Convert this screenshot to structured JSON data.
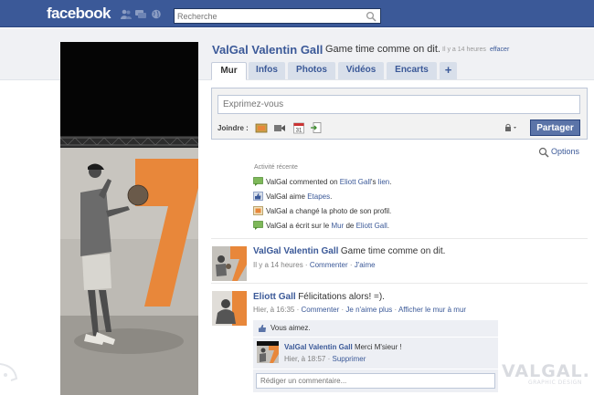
{
  "topbar": {
    "logo": "facebook",
    "search_placeholder": "Recherche"
  },
  "profile": {
    "name": "ValGal Valentin Gall",
    "status": "Game time comme on dit.",
    "status_time": "Il y a 14 heures",
    "clear_label": "effacer"
  },
  "tabs": [
    {
      "label": "Mur",
      "active": true
    },
    {
      "label": "Infos"
    },
    {
      "label": "Photos"
    },
    {
      "label": "Vidéos"
    },
    {
      "label": "Encarts"
    },
    {
      "label": "+"
    }
  ],
  "composer": {
    "placeholder": "Exprimez-vous",
    "attach_label": "Joindre :",
    "share_label": "Partager"
  },
  "options_label": "Options",
  "recent_activity": {
    "title": "Activité récente",
    "items": [
      {
        "before": "ValGal commented on ",
        "link1": "Eliott Gall",
        "mid": "'s ",
        "link2": "lien",
        "after": "."
      },
      {
        "before": "ValGal aime ",
        "link1": "Etapes",
        "mid": "",
        "link2": "",
        "after": "."
      },
      {
        "before": "ValGal a changé la photo de son profil.",
        "link1": "",
        "mid": "",
        "link2": "",
        "after": ""
      },
      {
        "before": "ValGal a écrit sur le ",
        "link1": "Mur",
        "mid": " de ",
        "link2": "Eliott Gall",
        "after": "."
      }
    ]
  },
  "posts": [
    {
      "name": "ValGal Valentin Gall",
      "message": "Game time comme on dit.",
      "time": "Il y a 14 heures",
      "actions": [
        "Commenter",
        "J'aime"
      ]
    },
    {
      "name": "Eliott Gall",
      "message": "Félicitations alors! =).",
      "time": "Hier, à 16:35",
      "actions": [
        "Commenter",
        "Je n'aime plus",
        "Afficher le mur à mur"
      ],
      "likes_text": "Vous aimez.",
      "reply": {
        "name": "ValGal Valentin Gall",
        "message": "Merci M'sieur !",
        "time": "Hier, à 18:57",
        "action": "Supprimer"
      },
      "comment_placeholder": "Rédiger un commentaire..."
    }
  ],
  "watermark": {
    "title": "VALGAL.",
    "subtitle": "GRAPHIC DESIGN"
  },
  "colors": {
    "brand": "#3b5998",
    "accent_orange": "#e8873a"
  }
}
